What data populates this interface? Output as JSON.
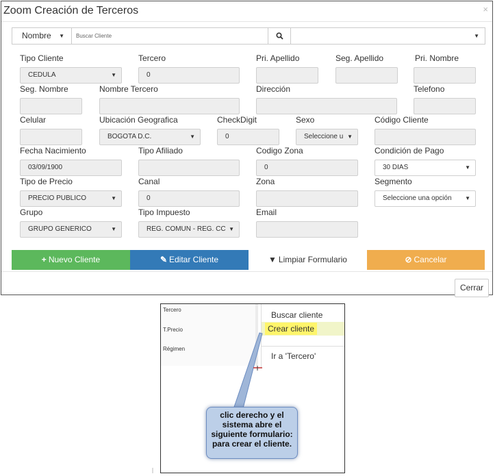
{
  "modal": {
    "title": "Zoom Creación de Terceros",
    "close_glyph": "×"
  },
  "search": {
    "type_value": "Nombre",
    "placeholder": "Buscar Cliente",
    "button_icon": "search-icon",
    "select_value": ""
  },
  "fields": {
    "tipo_cliente": {
      "label": "Tipo Cliente",
      "value": "CEDULA"
    },
    "tercero": {
      "label": "Tercero",
      "value": "0"
    },
    "pri_apellido": {
      "label": "Pri. Apellido",
      "value": ""
    },
    "seg_apellido": {
      "label": "Seg. Apellido",
      "value": ""
    },
    "pri_nombre": {
      "label": "Pri. Nombre",
      "value": ""
    },
    "seg_nombre": {
      "label": "Seg. Nombre",
      "value": ""
    },
    "nombre_tercero": {
      "label": "Nombre Tercero",
      "value": ""
    },
    "direccion": {
      "label": "Dirección",
      "value": ""
    },
    "telefono": {
      "label": "Telefono",
      "value": ""
    },
    "celular": {
      "label": "Celular",
      "value": ""
    },
    "ubicacion": {
      "label": "Ubicación Geografica",
      "value": "BOGOTA D.C."
    },
    "checkdigit": {
      "label": "CheckDigit",
      "value": "0"
    },
    "sexo": {
      "label": "Sexo",
      "value": "Seleccione u"
    },
    "codigo_cliente": {
      "label": "Código Cliente",
      "value": ""
    },
    "fecha_nacimiento": {
      "label": "Fecha Nacimiento",
      "value": "03/09/1900"
    },
    "tipo_afiliado": {
      "label": "Tipo Afiliado",
      "value": ""
    },
    "codigo_zona": {
      "label": "Codigo Zona",
      "value": "0"
    },
    "condicion_pago": {
      "label": "Condición de Pago",
      "value": "30 DIAS"
    },
    "tipo_precio": {
      "label": "Tipo de Precio",
      "value": "PRECIO PUBLICO"
    },
    "canal": {
      "label": "Canal",
      "value": "0"
    },
    "zona": {
      "label": "Zona",
      "value": ""
    },
    "segmento": {
      "label": "Segmento",
      "value": "Seleccione una opción"
    },
    "grupo": {
      "label": "Grupo",
      "value": "GRUPO GENERICO"
    },
    "tipo_impuesto": {
      "label": "Tipo Impuesto",
      "value": "REG. COMUN - REG. CC"
    },
    "email": {
      "label": "Email",
      "value": ""
    }
  },
  "actions": {
    "nuevo": {
      "icon": "+",
      "label": "Nuevo Cliente"
    },
    "editar": {
      "icon": "✎",
      "label": "Editar Cliente"
    },
    "limpiar": {
      "icon": "▼",
      "label": "Limpiar Formulario"
    },
    "cancelar": {
      "icon": "⊘",
      "label": "Cancelar"
    },
    "cerrar": "Cerrar"
  },
  "colors": {
    "green": "#5cb85c",
    "blue": "#337ab7",
    "orange": "#f0ad4e",
    "highlight": "#fff56b",
    "callout": "#bccfe8"
  },
  "context_screenshot": {
    "grid_labels": [
      "Tercero",
      "T.Precio",
      "Régimen"
    ],
    "menu": [
      "Buscar cliente",
      "Crear cliente",
      "Ir a 'Tercero'"
    ],
    "callout": "clic derecho y el sistema abre el siguiente formulario: para crear el cliente."
  }
}
